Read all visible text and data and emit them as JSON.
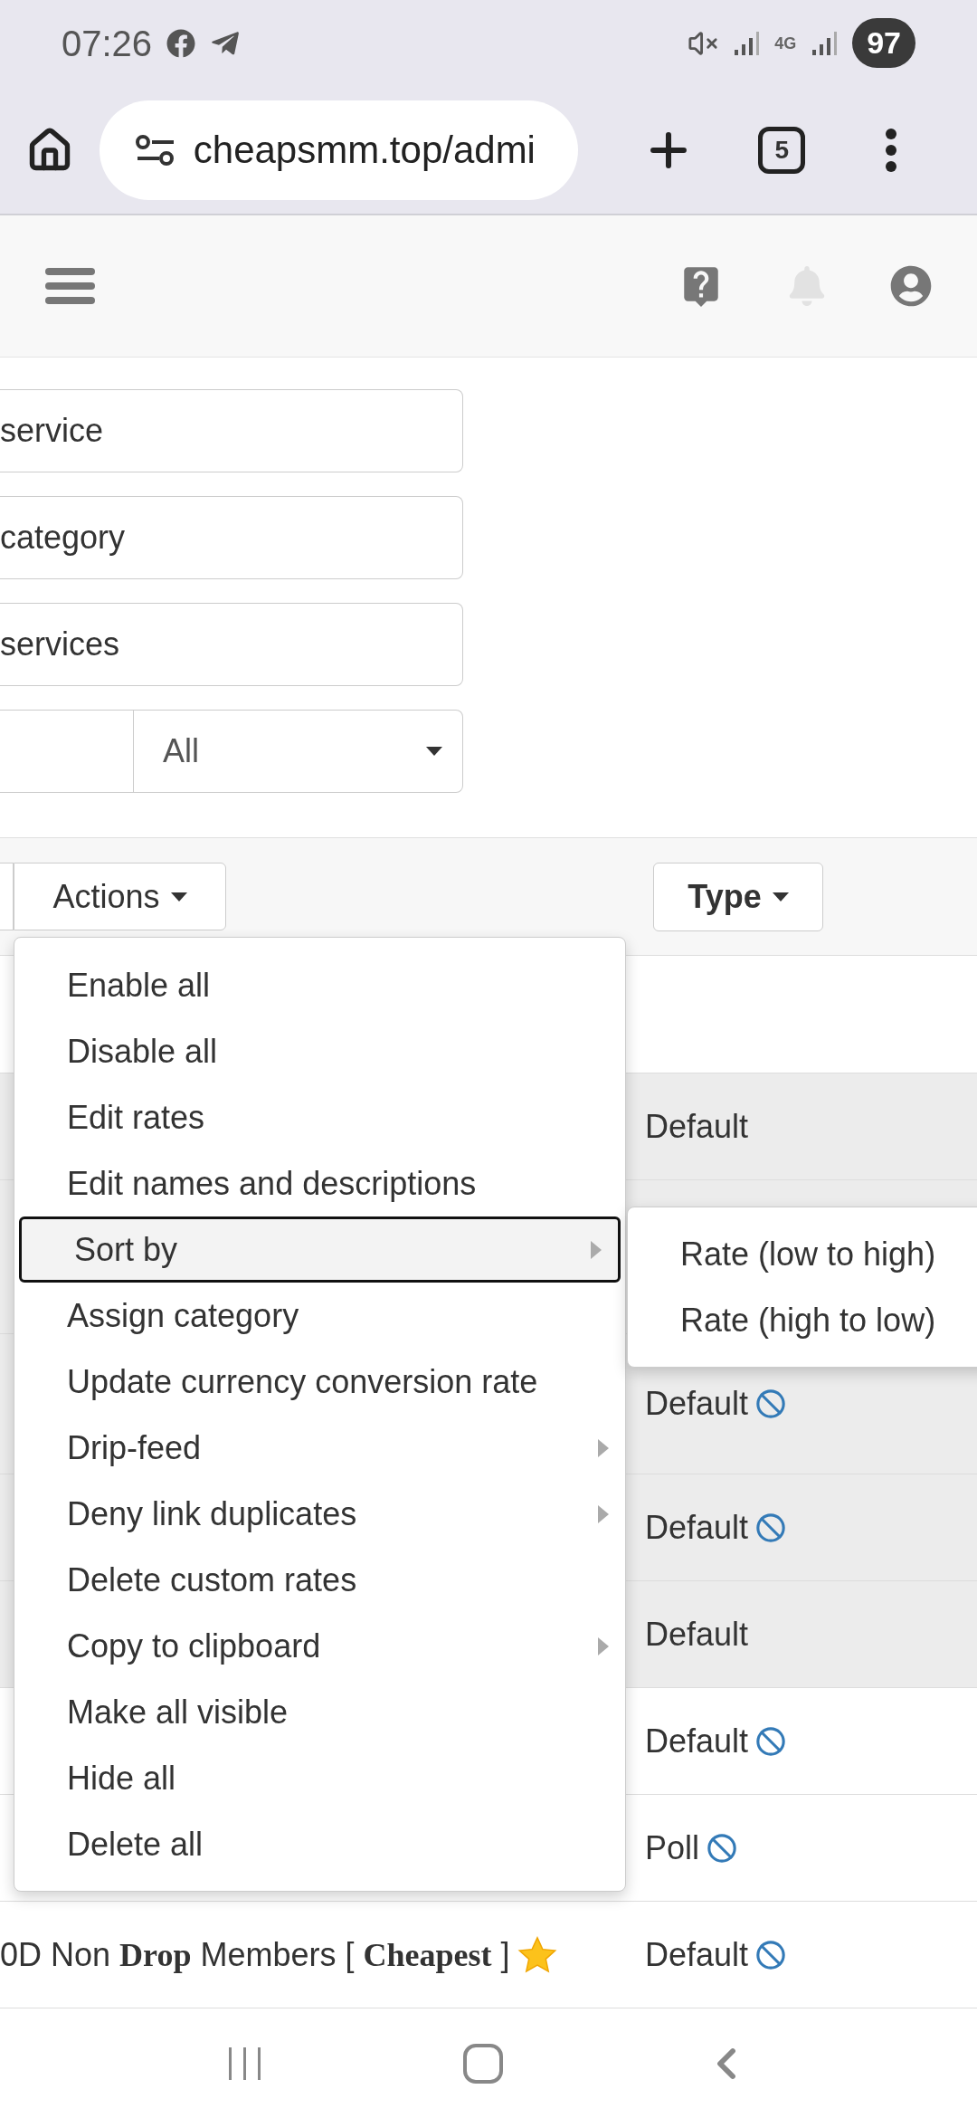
{
  "status_bar": {
    "time": "07:26",
    "network": "4G",
    "battery": "97"
  },
  "browser": {
    "url": "cheapsmm.top/admi",
    "tab_count": "5"
  },
  "filters": [
    {
      "kind": "input",
      "value": "service"
    },
    {
      "kind": "input",
      "value": "category"
    },
    {
      "kind": "input",
      "value": "services"
    },
    {
      "kind": "input_select",
      "value": "All"
    }
  ],
  "toolbar": {
    "actions_button": "Actions",
    "type_button": "Type"
  },
  "table": {
    "rows": [
      {
        "type": "Default",
        "disabled_icon": false,
        "shaded": true
      },
      {
        "shaded": true
      },
      {
        "type": "Default",
        "disabled_icon": true,
        "shaded": true
      },
      {
        "type": "Default",
        "disabled_icon": true,
        "shaded": true
      },
      {
        "type": "Default",
        "disabled_icon": false,
        "shaded": true
      },
      {
        "type": "Default",
        "disabled_icon": true,
        "shaded": false
      },
      {
        "type": "Poll",
        "disabled_icon": true,
        "shaded": false
      },
      {
        "service_lines": [
          "0D Non **Drop** Members [ **Cheapest** ]"
        ],
        "star": true,
        "type": "Default",
        "disabled_icon": true,
        "shaded": false
      }
    ]
  },
  "actions_menu": [
    {
      "label": "Enable all",
      "selected": false,
      "submenu": false
    },
    {
      "label": "Disable all",
      "selected": false,
      "submenu": false
    },
    {
      "label": "Edit rates",
      "selected": false,
      "submenu": false
    },
    {
      "label": "Edit names and descriptions",
      "selected": false,
      "submenu": false
    },
    {
      "label": "Sort by",
      "selected": true,
      "submenu": true
    },
    {
      "label": "Assign category",
      "selected": false,
      "submenu": false
    },
    {
      "label": "Update currency conversion rate",
      "selected": false,
      "submenu": false
    },
    {
      "label": "Drip-feed",
      "selected": false,
      "submenu": true
    },
    {
      "label": "Deny link duplicates",
      "selected": false,
      "submenu": true
    },
    {
      "label": "Delete custom rates",
      "selected": false,
      "submenu": false
    },
    {
      "label": "Copy to clipboard",
      "selected": false,
      "submenu": true
    },
    {
      "label": "Make all visible",
      "selected": false,
      "submenu": false
    },
    {
      "label": "Hide all",
      "selected": false,
      "submenu": false
    },
    {
      "label": "Delete all",
      "selected": false,
      "submenu": false
    }
  ],
  "sort_submenu": [
    "Rate (low to high)",
    "Rate (high to low)"
  ]
}
